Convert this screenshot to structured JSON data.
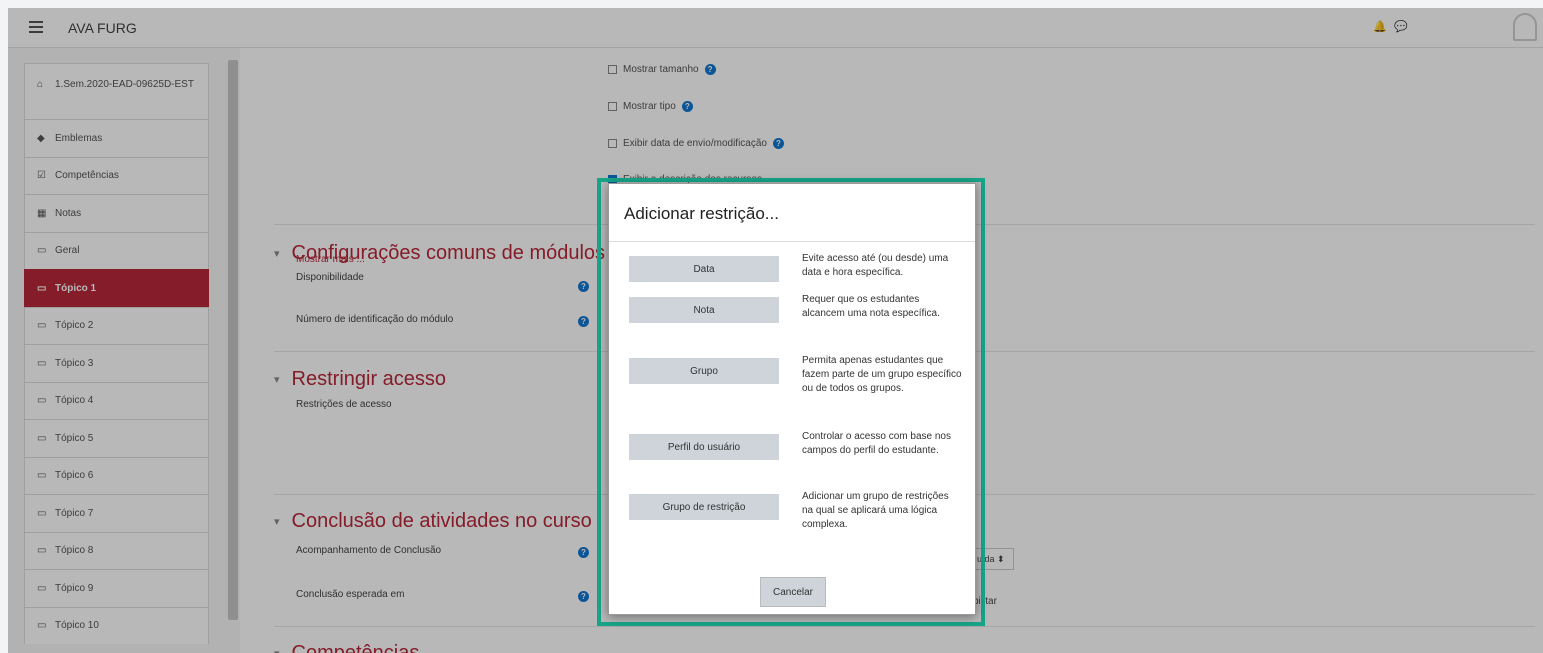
{
  "navbar": {
    "brand": "AVA FURG"
  },
  "sidebar": {
    "items": [
      {
        "label": "1.Sem.2020-EAD-09625D-EST",
        "icon": "graduation-cap-icon",
        "glyph": "⌂"
      },
      {
        "label": "Emblemas",
        "icon": "shield-icon",
        "glyph": "◆"
      },
      {
        "label": "Competências",
        "icon": "checklist-icon",
        "glyph": "☑"
      },
      {
        "label": "Notas",
        "icon": "table-icon",
        "glyph": "▦"
      },
      {
        "label": "Geral",
        "icon": "folder-icon",
        "glyph": "▭"
      },
      {
        "label": "Tópico 1",
        "icon": "folder-icon",
        "glyph": "▭",
        "active": true
      },
      {
        "label": "Tópico 2",
        "icon": "folder-icon",
        "glyph": "▭"
      },
      {
        "label": "Tópico 3",
        "icon": "folder-icon",
        "glyph": "▭"
      },
      {
        "label": "Tópico 4",
        "icon": "folder-icon",
        "glyph": "▭"
      },
      {
        "label": "Tópico 5",
        "icon": "folder-icon",
        "glyph": "▭"
      },
      {
        "label": "Tópico 6",
        "icon": "folder-icon",
        "glyph": "▭"
      },
      {
        "label": "Tópico 7",
        "icon": "folder-icon",
        "glyph": "▭"
      },
      {
        "label": "Tópico 8",
        "icon": "folder-icon",
        "glyph": "▭"
      },
      {
        "label": "Tópico 9",
        "icon": "folder-icon",
        "glyph": "▭"
      },
      {
        "label": "Tópico 10",
        "icon": "folder-icon",
        "glyph": "▭"
      }
    ]
  },
  "main": {
    "checkboxes": [
      {
        "label": "Mostrar tamanho",
        "checked": false
      },
      {
        "label": "Mostrar tipo",
        "checked": false
      },
      {
        "label": "Exibir data de envio/modificação",
        "checked": false
      },
      {
        "label": "Exibir a descrição dos recursos",
        "checked": true
      }
    ],
    "show_more": "Mostrar mais ...",
    "sections": {
      "common": "Configurações comuns de módulos",
      "restrict": "Restringir acesso",
      "completion": "Conclusão de atividades no curso",
      "competencies": "Competências"
    },
    "labels": {
      "availability": "Disponibilidade",
      "idnumber": "Número de identificação do módulo",
      "restrictions": "Restrições de acesso",
      "tracking": "Acompanhamento de Conclusão",
      "expected": "Conclusão esperada em"
    },
    "fragments": {
      "select": "uída",
      "select_arrow": "⬍",
      "enable": "bilitar"
    }
  },
  "modal": {
    "title": "Adicionar restrição...",
    "options": [
      {
        "button": "Data",
        "description": "Evite acesso até (ou desde) uma data e hora específica."
      },
      {
        "button": "Nota",
        "description": "Requer que os estudantes alcancem uma nota específica."
      },
      {
        "button": "Grupo",
        "description": "Permita apenas estudantes que fazem parte de um grupo específico ou de todos os grupos."
      },
      {
        "button": "Perfil do usuário",
        "description": "Controlar o acesso com base nos campos do perfil do estudante."
      },
      {
        "button": "Grupo de restrição",
        "description": "Adicionar um grupo de restrições na qual se aplicará uma lógica complexa."
      }
    ],
    "cancel": "Cancelar"
  },
  "colors": {
    "accent": "#b8273a",
    "highlight": "#17a589",
    "help": "#1177d1"
  }
}
